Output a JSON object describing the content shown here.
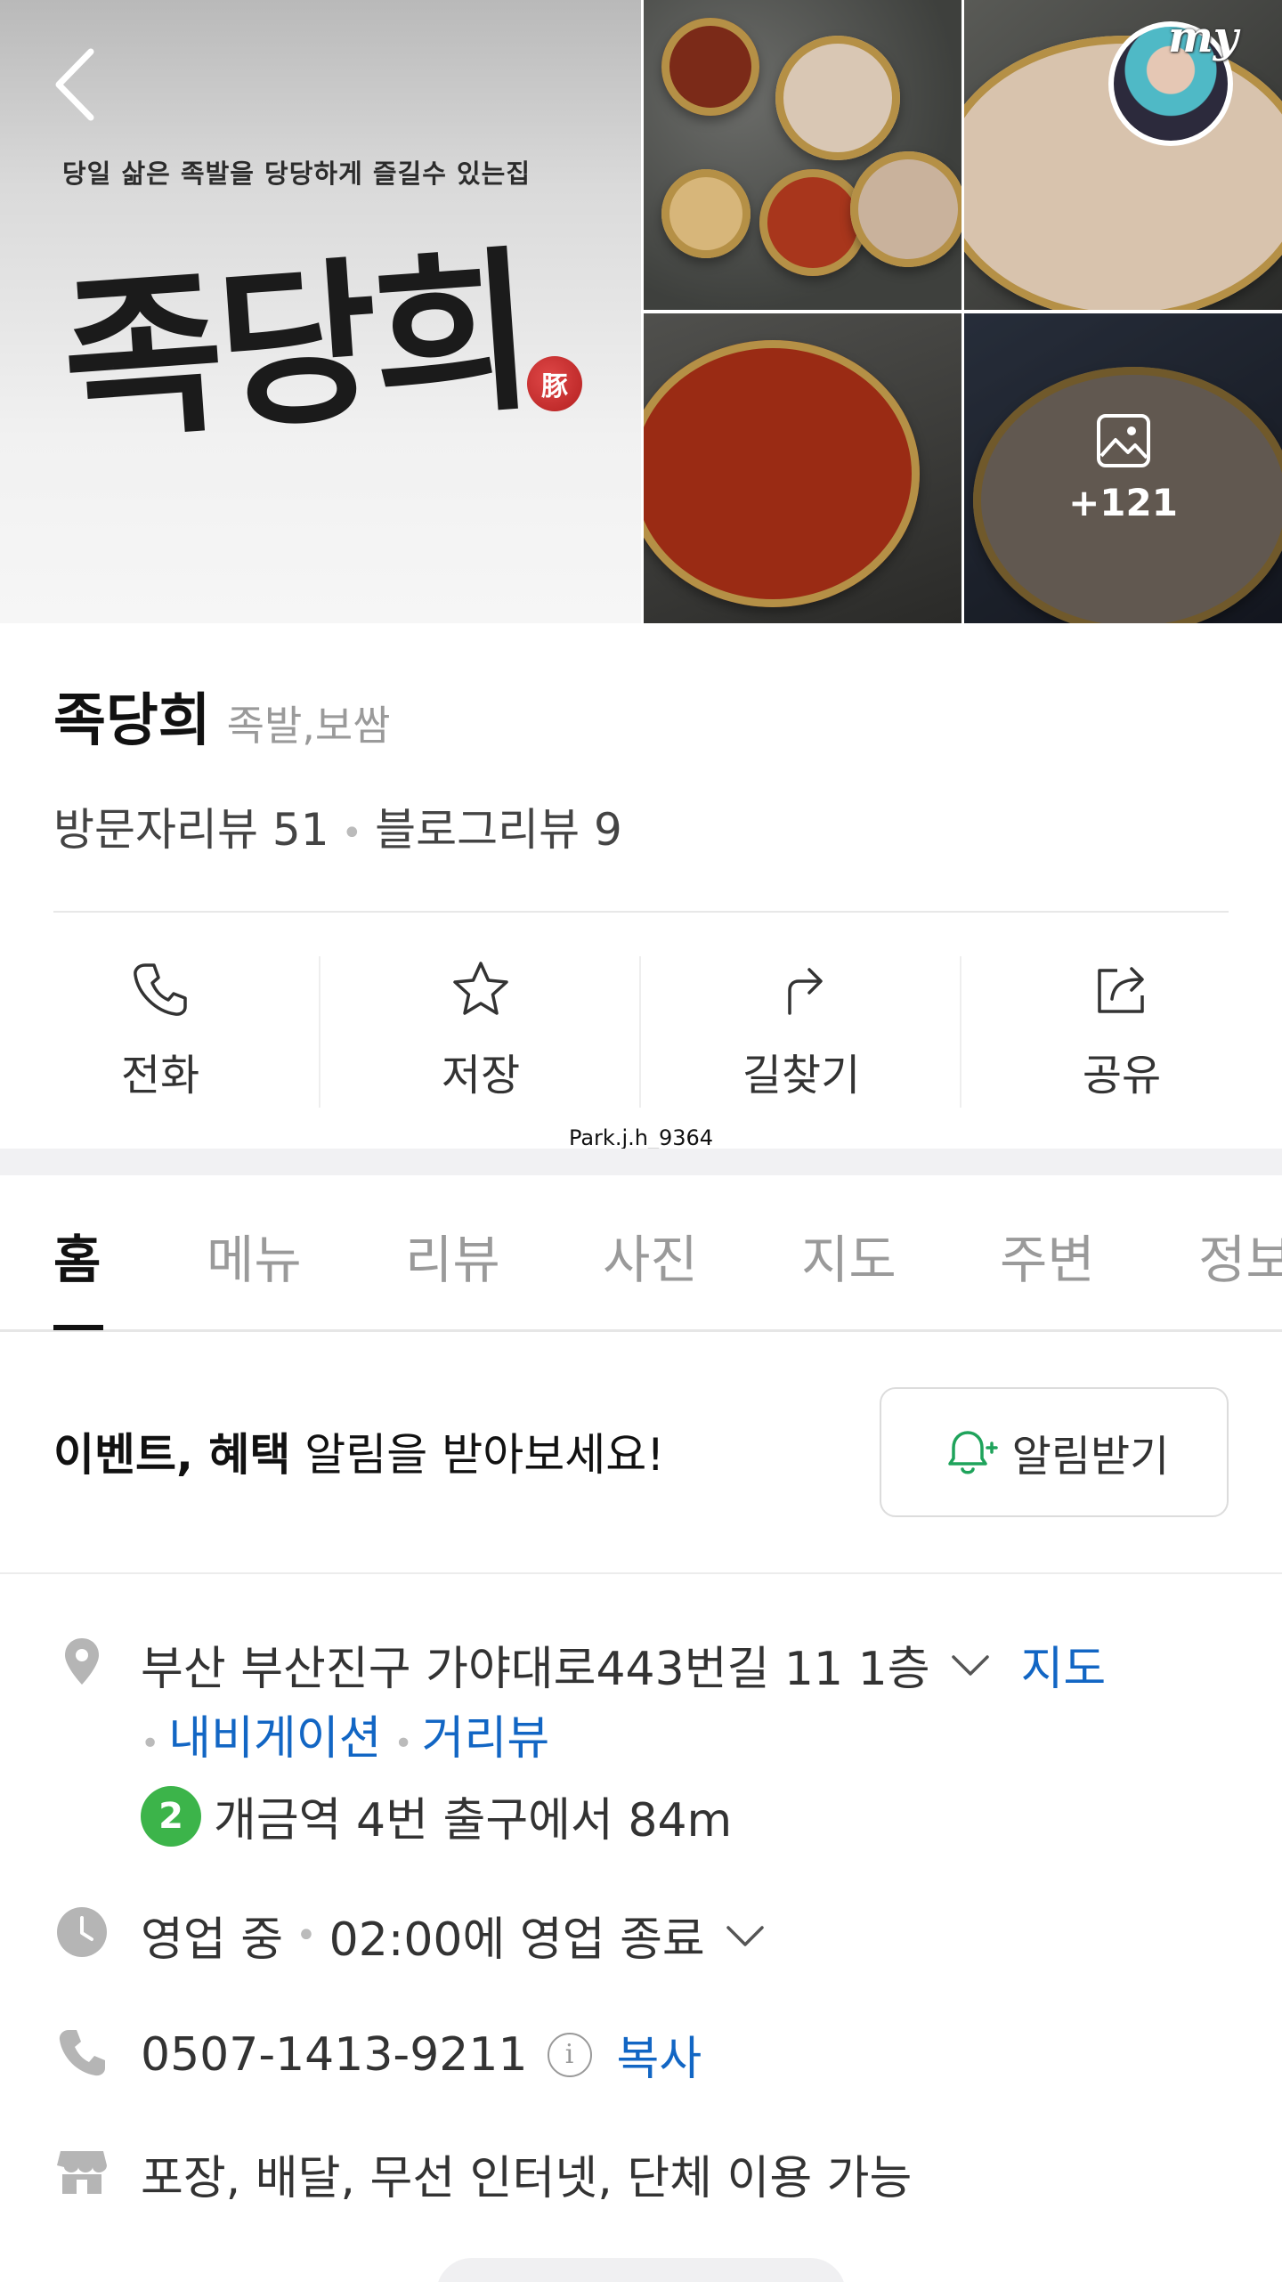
{
  "hero": {
    "tagline": "당일 삶은 족발을 당당하게 즐길수 있는집",
    "brand_text": "족당희",
    "seal_text": "豚",
    "more_photos": "+121",
    "my_badge": "my"
  },
  "place": {
    "name": "족당희",
    "category": "족발,보쌈",
    "visitor_reviews": "방문자리뷰 51",
    "blog_reviews": "블로그리뷰 9"
  },
  "actions": [
    {
      "label": "전화",
      "icon": "phone-icon"
    },
    {
      "label": "저장",
      "icon": "star-icon"
    },
    {
      "label": "길찾기",
      "icon": "directions-icon"
    },
    {
      "label": "공유",
      "icon": "share-icon"
    }
  ],
  "watermark": "Park.j.h_9364",
  "tabs": [
    "홈",
    "메뉴",
    "리뷰",
    "사진",
    "지도",
    "주변",
    "정보"
  ],
  "active_tab": "홈",
  "event": {
    "bold_text": "이벤트, 혜택",
    "text": " 알림을 받아보세요!",
    "button_label": "알림받기"
  },
  "address": {
    "text": "부산 부산진구 가야대로443번길 11 1층",
    "map_link": "지도",
    "navigation_link": "내비게이션",
    "street_view_link": "거리뷰",
    "subway_line": "2",
    "subway_text": "개금역 4번 출구에서 84m"
  },
  "hours": {
    "status": "영업 중",
    "detail": "02:00에 영업 종료"
  },
  "phone": {
    "number": "0507-1413-9211",
    "copy_label": "복사"
  },
  "amenities": "포장, 배달, 무선 인터넷, 단체 이용 가능",
  "colors": {
    "link": "#1266c4",
    "subway_line_2": "#3cb44a",
    "notify_bell": "#1fa35b"
  }
}
